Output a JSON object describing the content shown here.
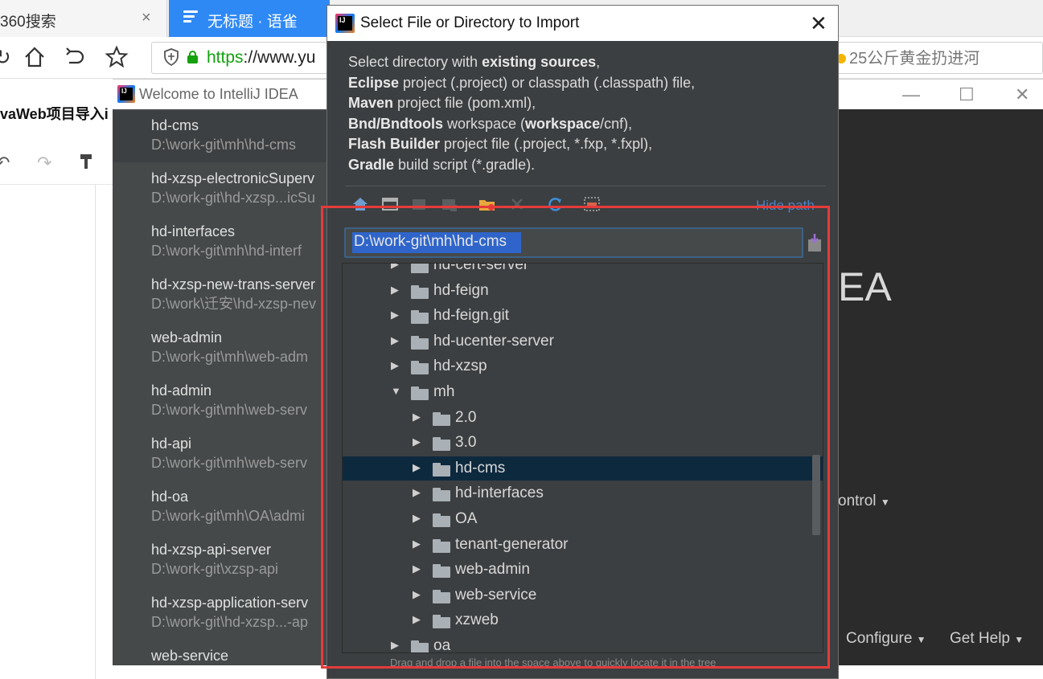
{
  "browser": {
    "tabs": [
      {
        "label": "360搜索",
        "close": "×"
      },
      {
        "label": "无标题 · 语雀"
      }
    ],
    "url_scheme": "https",
    "url_rest": "://www.yu",
    "suggestion": "25公斤黄金扔进河"
  },
  "document": {
    "title": "vaWeb项目导入i"
  },
  "intellij": {
    "window_title": "Welcome to IntelliJ IDEA",
    "logo_text": "IJ",
    "recent_projects": [
      {
        "name": "hd-cms",
        "path": "D:\\work-git\\mh\\hd-cms"
      },
      {
        "name": "hd-xzsp-electronicSuperv",
        "path": "D:\\work-git\\hd-xzsp...icSu"
      },
      {
        "name": "hd-interfaces",
        "path": "D:\\work-git\\mh\\hd-interf"
      },
      {
        "name": "hd-xzsp-new-trans-server",
        "path": "D:\\work\\迁安\\hd-xzsp-nev"
      },
      {
        "name": "web-admin",
        "path": "D:\\work-git\\mh\\web-adm"
      },
      {
        "name": "hd-admin",
        "path": "D:\\work-git\\mh\\web-serv"
      },
      {
        "name": "hd-api",
        "path": "D:\\work-git\\mh\\web-serv"
      },
      {
        "name": "hd-oa",
        "path": "D:\\work-git\\mh\\OA\\admi"
      },
      {
        "name": "hd-xzsp-api-server",
        "path": "D:\\work-git\\xzsp-api"
      },
      {
        "name": "hd-xzsp-application-serv",
        "path": "D:\\work-git\\hd-xzsp...-ap"
      },
      {
        "name": "web-service",
        "path": ""
      }
    ],
    "big_text": "EA",
    "control_label": "ontrol",
    "configure_label": "Configure",
    "help_label": "Get Help"
  },
  "dialog": {
    "title": "Select File or Directory to Import",
    "description": [
      {
        "bold": "",
        "text": "Select directory with ",
        "bold2": "existing sources",
        "tail": ","
      },
      {
        "bold": "Eclipse",
        "text": " project (.project) or classpath (.classpath) file,",
        "bold2": "",
        "tail": ""
      },
      {
        "bold": "Maven",
        "text": " project file (pom.xml),",
        "bold2": "",
        "tail": ""
      },
      {
        "bold": "Bnd/Bndtools",
        "text": " workspace (",
        "bold2": "workspace",
        "tail": "/cnf),"
      },
      {
        "bold": "Flash Builder",
        "text": " project file (.project, *.fxp, *.fxpl),",
        "bold2": "",
        "tail": ""
      },
      {
        "bold": "Gradle",
        "text": " build script (*.gradle).",
        "bold2": "",
        "tail": ""
      }
    ],
    "hide_path": "Hide path",
    "path_value": "D:\\work-git\\mh\\hd-cms",
    "tree": [
      {
        "label": "hd-cert-server",
        "level": 0,
        "expanded": false
      },
      {
        "label": "hd-feign",
        "level": 0,
        "expanded": false
      },
      {
        "label": "hd-feign.git",
        "level": 0,
        "expanded": false
      },
      {
        "label": "hd-ucenter-server",
        "level": 0,
        "expanded": false
      },
      {
        "label": "hd-xzsp",
        "level": 0,
        "expanded": false
      },
      {
        "label": "mh",
        "level": 0,
        "expanded": true
      },
      {
        "label": "2.0",
        "level": 1,
        "expanded": false
      },
      {
        "label": "3.0",
        "level": 1,
        "expanded": false
      },
      {
        "label": "hd-cms",
        "level": 1,
        "expanded": false,
        "selected": true
      },
      {
        "label": "hd-interfaces",
        "level": 1,
        "expanded": false
      },
      {
        "label": "OA",
        "level": 1,
        "expanded": false
      },
      {
        "label": "tenant-generator",
        "level": 1,
        "expanded": false
      },
      {
        "label": "web-admin",
        "level": 1,
        "expanded": false
      },
      {
        "label": "web-service",
        "level": 1,
        "expanded": false
      },
      {
        "label": "xzweb",
        "level": 1,
        "expanded": false
      },
      {
        "label": "oa",
        "level": 0,
        "expanded": false
      }
    ],
    "hint": "Drag and drop a file into the space above to quickly locate it in the tree"
  },
  "colors": {
    "selection": "#0d293e",
    "highlight_box": "#e53b3b",
    "browser_tab_active": "#2f89f5"
  }
}
